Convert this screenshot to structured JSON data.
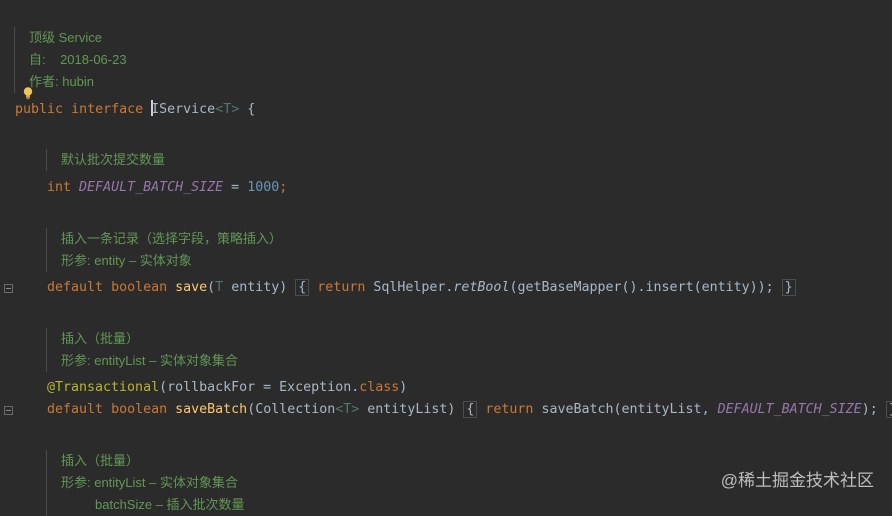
{
  "class_doc": {
    "line1": "顶级 Service",
    "line2_label": "自:",
    "line2_value": "2018-06-23",
    "line3": "作者: hubin"
  },
  "class_decl": {
    "kw_public": "public",
    "kw_interface": "interface",
    "name": "IService",
    "type_param": "<T>",
    "open": " {"
  },
  "batch_doc": {
    "line1": "默认批次提交数量"
  },
  "batch_field": {
    "type": "int",
    "name": "DEFAULT_BATCH_SIZE",
    "eq": " = ",
    "value": "1000",
    "semi": ";"
  },
  "save_doc": {
    "line1": "插入一条记录（选择字段，策略插入）",
    "line2": "形参: entity – 实体对象"
  },
  "save_method": {
    "kw_default": "default",
    "kw_boolean": "boolean",
    "name": "save",
    "params_open": "(",
    "param_type": "T",
    "param_name": " entity",
    "params_close": ")",
    "body_open": "{",
    "kw_return": "return",
    "call1": " SqlHelper.",
    "call1_fn": "retBool",
    "call2": "(getBaseMapper().insert(entity));",
    "body_close": "}"
  },
  "savebatch_doc": {
    "line1": "插入（批量）",
    "line2": "形参: entityList – 实体对象集合"
  },
  "savebatch_annotation": {
    "name": "@Transactional",
    "args_open": "(rollbackFor = Exception.",
    "kw_class": "class",
    "args_close": ")"
  },
  "savebatch_method": {
    "kw_default": "default",
    "kw_boolean": "boolean",
    "name": "saveBatch",
    "params_open": "(Collection",
    "param_tp": "<T>",
    "param_rest": " entityList)",
    "body_open": "{",
    "kw_return": "return",
    "call": " saveBatch(entityList, ",
    "const": "DEFAULT_BATCH_SIZE",
    "call_end": ");",
    "body_close": "}"
  },
  "savebatch2_doc": {
    "line1": "插入（批量）",
    "line2": "形参: entityList – 实体对象集合",
    "line3": "batchSize – 插入批次数量"
  },
  "watermark": "@稀土掘金技术社区",
  "colors": {
    "background": "#2b2b2b",
    "keyword": "#cc7832",
    "doc_comment": "#629755",
    "number": "#6897bb",
    "constant": "#9876aa",
    "method": "#ffc66d",
    "annotation": "#bbb529"
  }
}
